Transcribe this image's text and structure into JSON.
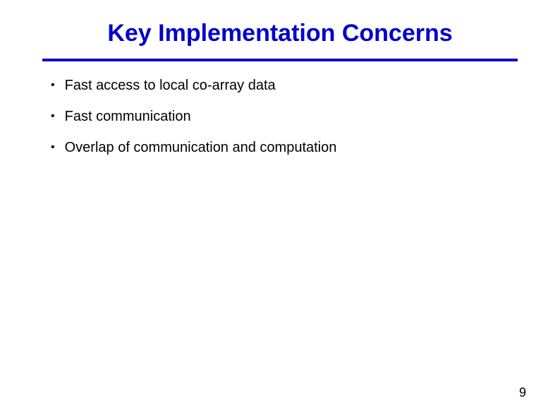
{
  "slide": {
    "title": "Key Implementation Concerns",
    "bullets": [
      "Fast access to local co-array data",
      "Fast communication",
      "Overlap of communication and computation"
    ],
    "page_number": "9"
  }
}
